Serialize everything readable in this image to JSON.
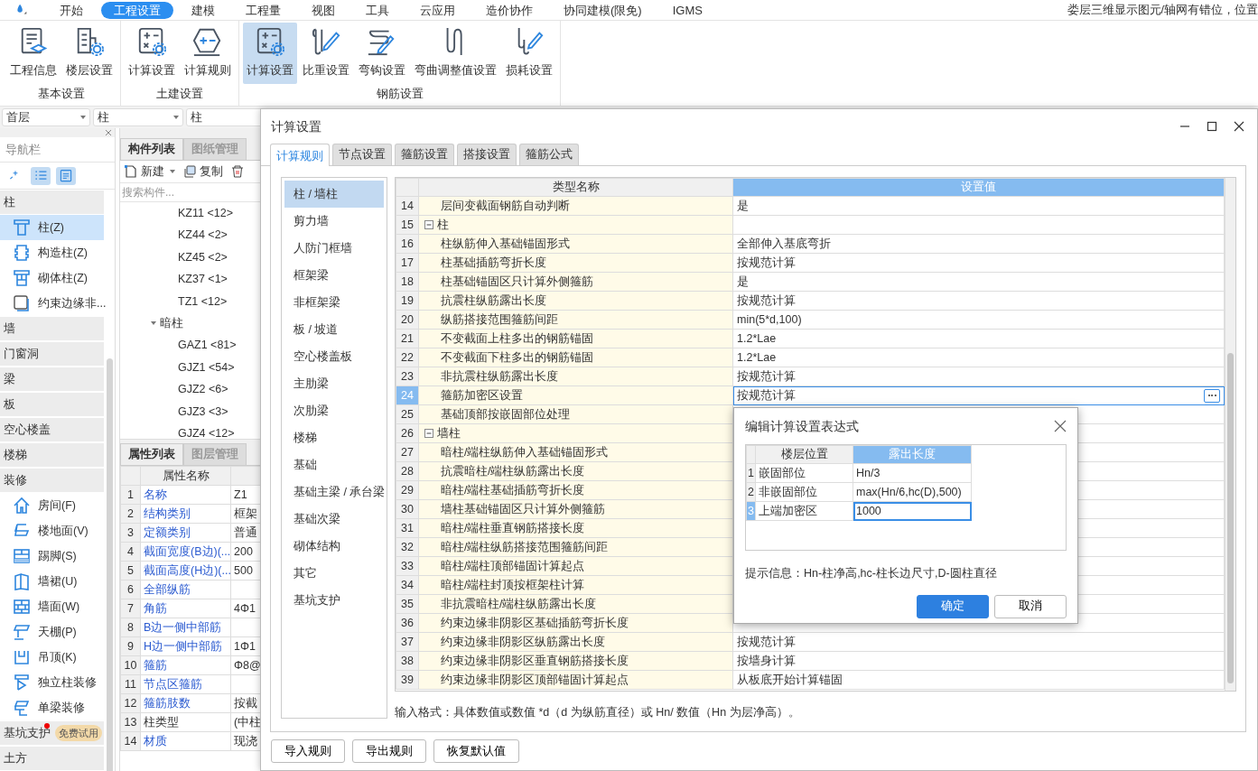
{
  "menu_bar": {
    "tabs": [
      {
        "label": "开始",
        "selected": false
      },
      {
        "label": "工程设置",
        "selected": true
      },
      {
        "label": "建模",
        "selected": false
      },
      {
        "label": "工程量",
        "selected": false
      },
      {
        "label": "视图",
        "selected": false
      },
      {
        "label": "工具",
        "selected": false
      },
      {
        "label": "云应用",
        "selected": false
      },
      {
        "label": "造价协作",
        "selected": false
      },
      {
        "label": "协同建模(限免)",
        "selected": false
      },
      {
        "label": "IGMS",
        "selected": false
      }
    ],
    "status_text": "娄层三维显示图元/轴网有错位，位置"
  },
  "ribbon": {
    "groups": [
      {
        "title": "基本设置",
        "buttons": [
          {
            "label": "工程信息",
            "selected": false
          },
          {
            "label": "楼层设置",
            "selected": false
          }
        ]
      },
      {
        "title": "土建设置",
        "buttons": [
          {
            "label": "计算设置",
            "selected": false
          },
          {
            "label": "计算规则",
            "selected": false
          }
        ]
      },
      {
        "title": "钢筋设置",
        "buttons": [
          {
            "label": "计算设置",
            "selected": true
          },
          {
            "label": "比重设置",
            "selected": false
          },
          {
            "label": "弯钩设置",
            "selected": false
          },
          {
            "label": "弯曲调整值设置",
            "selected": false
          },
          {
            "label": "损耗设置",
            "selected": false
          }
        ]
      }
    ]
  },
  "selectors": [
    {
      "value": "首层"
    },
    {
      "value": "柱"
    },
    {
      "value": "柱"
    }
  ],
  "navigator": {
    "title": "导航栏",
    "toolbar": [
      {
        "on": false
      },
      {
        "on": true
      },
      {
        "on": true
      }
    ],
    "categories": [
      {
        "label": "柱",
        "items": [
          {
            "label": "柱(Z)",
            "selected": true
          },
          {
            "label": "构造柱(Z)",
            "selected": false
          },
          {
            "label": "砌体柱(Z)",
            "selected": false
          },
          {
            "label": "约束边缘非...",
            "selected": false
          }
        ]
      },
      {
        "label": "墙"
      },
      {
        "label": "门窗洞"
      },
      {
        "label": "梁"
      },
      {
        "label": "板"
      },
      {
        "label": "空心楼盖"
      },
      {
        "label": "楼梯"
      },
      {
        "label": "装修",
        "items": [
          {
            "label": "房间(F)",
            "selected": false
          },
          {
            "label": "楼地面(V)",
            "selected": false
          },
          {
            "label": "踢脚(S)",
            "selected": false
          },
          {
            "label": "墙裙(U)",
            "selected": false
          },
          {
            "label": "墙面(W)",
            "selected": false
          },
          {
            "label": "天棚(P)",
            "selected": false
          },
          {
            "label": "吊顶(K)",
            "selected": false
          },
          {
            "label": "独立柱装修",
            "selected": false
          },
          {
            "label": "单梁装修",
            "selected": false
          }
        ]
      },
      {
        "label": "基坑支护",
        "new_dot": true,
        "badge": "免费试用"
      },
      {
        "label": "土方"
      }
    ]
  },
  "component_panel": {
    "tabs": [
      {
        "label": "构件列表",
        "selected": true
      },
      {
        "label": "图纸管理",
        "selected": false
      }
    ],
    "toolbar": [
      {
        "label": "新建",
        "kind": "dropdown"
      },
      {
        "label": "复制",
        "kind": "button"
      }
    ],
    "search": {
      "placeholder": "搜索构件..."
    },
    "tree": [
      {
        "label": "KZ11 <12>"
      },
      {
        "label": "KZ44 <2>"
      },
      {
        "label": "KZ45 <2>"
      },
      {
        "label": "KZ37 <1>"
      },
      {
        "label": "TZ1 <12>"
      },
      {
        "label": "暗柱",
        "expanded": true,
        "children": [
          {
            "label": "GAZ1 <81>"
          },
          {
            "label": "GJZ1 <54>"
          },
          {
            "label": "GJZ2 <6>"
          },
          {
            "label": "GJZ3 <3>"
          },
          {
            "label": "GJZ4 <12>"
          }
        ]
      }
    ]
  },
  "property_panel": {
    "tabs": [
      {
        "label": "属性列表",
        "selected": true
      },
      {
        "label": "图层管理",
        "selected": false
      }
    ],
    "column": "属性名称",
    "rows": [
      {
        "num": "1",
        "name": "名称",
        "value": "Z1",
        "public": true
      },
      {
        "num": "2",
        "name": "结构类别",
        "value": "框架",
        "public": true
      },
      {
        "num": "3",
        "name": "定额类别",
        "value": "普通",
        "public": true
      },
      {
        "num": "4",
        "name": "截面宽度(B边)(...",
        "value": "200",
        "public": true
      },
      {
        "num": "5",
        "name": "截面高度(H边)(...",
        "value": "500",
        "public": true
      },
      {
        "num": "6",
        "name": "全部纵筋",
        "public": true
      },
      {
        "num": "7",
        "name": "角筋",
        "value": "4Φ1",
        "public": true
      },
      {
        "num": "8",
        "name": "B边一侧中部筋",
        "public": true
      },
      {
        "num": "9",
        "name": "H边一侧中部筋",
        "value": "1Φ1",
        "public": true
      },
      {
        "num": "10",
        "name": "箍筋",
        "value": "Φ8@",
        "public": true
      },
      {
        "num": "11",
        "name": "节点区箍筋",
        "public": true
      },
      {
        "num": "12",
        "name": "箍筋肢数",
        "value": "按截",
        "public": true
      },
      {
        "num": "13",
        "name": "柱类型",
        "value": "(中柱",
        "public": false
      },
      {
        "num": "14",
        "name": "材质",
        "value": "现浇",
        "public": true
      }
    ]
  },
  "dialog": {
    "title": "计算设置",
    "tabs": [
      {
        "label": "计算规则",
        "selected": true
      },
      {
        "label": "节点设置",
        "selected": false
      },
      {
        "label": "箍筋设置",
        "selected": false
      },
      {
        "label": "搭接设置",
        "selected": false
      },
      {
        "label": "箍筋公式",
        "selected": false
      }
    ],
    "categories": [
      {
        "label": "柱 / 墙柱",
        "selected": true
      },
      {
        "label": "剪力墙",
        "selected": false
      },
      {
        "label": "人防门框墙",
        "selected": false
      },
      {
        "label": "框架梁",
        "selected": false
      },
      {
        "label": "非框架梁",
        "selected": false
      },
      {
        "label": "板 / 坡道",
        "selected": false
      },
      {
        "label": "空心楼盖板",
        "selected": false
      },
      {
        "label": "主肋梁",
        "selected": false
      },
      {
        "label": "次肋梁",
        "selected": false
      },
      {
        "label": "楼梯",
        "selected": false
      },
      {
        "label": "基础",
        "selected": false
      },
      {
        "label": "基础主梁 / 承台梁",
        "selected": false
      },
      {
        "label": "基础次梁",
        "selected": false
      },
      {
        "label": "砌体结构",
        "selected": false
      },
      {
        "label": "其它",
        "selected": false
      },
      {
        "label": "基坑支护",
        "selected": false
      }
    ],
    "table": {
      "columns": [
        "类型名称",
        "设置值"
      ],
      "rows": [
        {
          "num": "14",
          "kind": "item",
          "name": "层间变截面钢筋自动判断",
          "value": "是",
          "selected": false
        },
        {
          "num": "15",
          "kind": "group",
          "name": "柱",
          "expanded": true,
          "selected": false
        },
        {
          "num": "16",
          "kind": "item",
          "name": "柱纵筋伸入基础锚固形式",
          "value": "全部伸入基底弯折",
          "selected": false
        },
        {
          "num": "17",
          "kind": "item",
          "name": "柱基础插筋弯折长度",
          "value": "按规范计算",
          "selected": false
        },
        {
          "num": "18",
          "kind": "item",
          "name": "柱基础锚固区只计算外侧箍筋",
          "value": "是",
          "selected": false
        },
        {
          "num": "19",
          "kind": "item",
          "name": "抗震柱纵筋露出长度",
          "value": "按规范计算",
          "selected": false
        },
        {
          "num": "20",
          "kind": "item",
          "name": "纵筋搭接范围箍筋间距",
          "value": "min(5*d,100)",
          "selected": false
        },
        {
          "num": "21",
          "kind": "item",
          "name": "不变截面上柱多出的钢筋锚固",
          "value": "1.2*Lae",
          "selected": false
        },
        {
          "num": "22",
          "kind": "item",
          "name": "不变截面下柱多出的钢筋锚固",
          "value": "1.2*Lae",
          "selected": false
        },
        {
          "num": "23",
          "kind": "item",
          "name": "非抗震柱纵筋露出长度",
          "value": "按规范计算",
          "selected": false
        },
        {
          "num": "24",
          "kind": "item",
          "name": "箍筋加密区设置",
          "value": "按规范计算",
          "selected": true
        },
        {
          "num": "25",
          "kind": "item",
          "name": "基础顶部按嵌固部位处理",
          "selected": false
        },
        {
          "num": "26",
          "kind": "group",
          "name": "墙柱",
          "expanded": true,
          "selected": false
        },
        {
          "num": "27",
          "kind": "item",
          "name": "暗柱/端柱纵筋伸入基础锚固形式",
          "selected": false
        },
        {
          "num": "28",
          "kind": "item",
          "name": "抗震暗柱/端柱纵筋露出长度",
          "selected": false
        },
        {
          "num": "29",
          "kind": "item",
          "name": "暗柱/端柱基础插筋弯折长度",
          "selected": false
        },
        {
          "num": "30",
          "kind": "item",
          "name": "墙柱基础锚固区只计算外侧箍筋",
          "selected": false
        },
        {
          "num": "31",
          "kind": "item",
          "name": "暗柱/端柱垂直钢筋搭接长度",
          "selected": false
        },
        {
          "num": "32",
          "kind": "item",
          "name": "暗柱/端柱纵筋搭接范围箍筋间距",
          "selected": false
        },
        {
          "num": "33",
          "kind": "item",
          "name": "暗柱/端柱顶部锚固计算起点",
          "selected": false
        },
        {
          "num": "34",
          "kind": "item",
          "name": "暗柱/端柱封顶按框架柱计算",
          "selected": false
        },
        {
          "num": "35",
          "kind": "item",
          "name": "非抗震暗柱/端柱纵筋露出长度",
          "selected": false
        },
        {
          "num": "36",
          "kind": "item",
          "name": "约束边缘非阴影区基础插筋弯折长度",
          "selected": false
        },
        {
          "num": "37",
          "kind": "item",
          "name": "约束边缘非阴影区纵筋露出长度",
          "value": "按规范计算",
          "selected": false
        },
        {
          "num": "38",
          "kind": "item",
          "name": "约束边缘非阴影区垂直钢筋搭接长度",
          "value": "按墙身计算",
          "selected": false
        },
        {
          "num": "39",
          "kind": "item",
          "name": "约束边缘非阴影区顶部锚固计算起点",
          "value": "从板底开始计算锚固",
          "selected": false
        }
      ]
    },
    "hint": "输入格式：具体数值或数值 *d（d 为纵筋直径）或 Hn/ 数值（Hn 为层净高）。",
    "buttons": [
      "导入规则",
      "导出规则",
      "恢复默认值"
    ]
  },
  "expression_dialog": {
    "title": "编辑计算设置表达式",
    "columns": [
      "楼层位置",
      "露出长度"
    ],
    "rows": [
      {
        "num": "1",
        "position": "嵌固部位",
        "length": "Hn/3",
        "selected": false
      },
      {
        "num": "2",
        "position": "非嵌固部位",
        "length": "max(Hn/6,hc(D),500)",
        "selected": false
      },
      {
        "num": "3",
        "position": "上端加密区",
        "length": "1000",
        "selected": true
      }
    ],
    "hint": "提示信息：Hn-柱净高,hc-柱长边尺寸,D-圆柱直径",
    "buttons": [
      {
        "label": "确定",
        "primary": true
      },
      {
        "label": "取消",
        "primary": false
      }
    ]
  }
}
